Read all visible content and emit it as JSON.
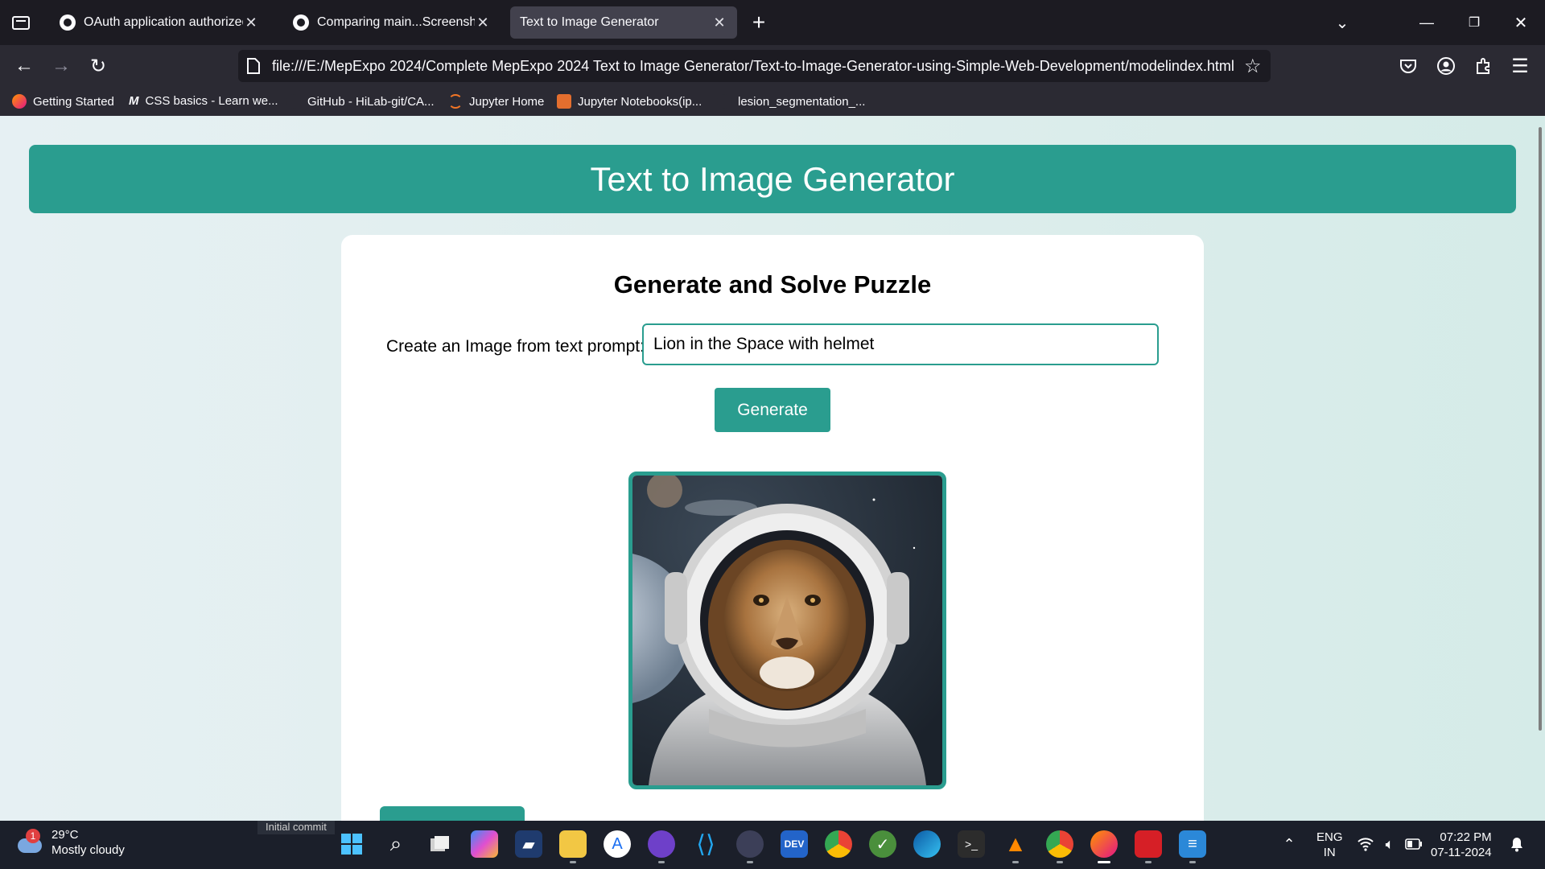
{
  "browser": {
    "tabs": [
      {
        "title": "OAuth application authorized",
        "active": false
      },
      {
        "title": "Comparing main...Screenshot-o",
        "active": false
      },
      {
        "title": "Text to Image Generator",
        "active": true
      }
    ],
    "new_tab_symbol": "+",
    "url": "file:///E:/MepExpo 2024/Complete MepExpo 2024 Text to Image Generator/Text-to-Image-Generator-using-Simple-Web-Development/modelindex.html?user",
    "bookmarks": [
      {
        "label": "Getting Started",
        "icon": "firefox-icon"
      },
      {
        "label": "CSS basics - Learn we...",
        "icon": "mdn-icon"
      },
      {
        "label": "GitHub - HiLab-git/CA...",
        "icon": "github-icon"
      },
      {
        "label": "Jupyter Home",
        "icon": "jupyter-icon"
      },
      {
        "label": "Jupyter Notebooks(ip...",
        "icon": "notebook-icon"
      },
      {
        "label": "lesion_segmentation_...",
        "icon": "page-icon"
      }
    ]
  },
  "page": {
    "header_title": "Text to Image Generator",
    "card_title": "Generate and Solve Puzzle",
    "prompt_label": "Create an Image from text prompt:",
    "prompt_value": "Lion in the Space with helmet",
    "generate_label": "Generate",
    "accent_color": "#2a9d8f"
  },
  "taskbar": {
    "weather_badge": "1",
    "temperature": "29°C",
    "condition": "Mostly cloudy",
    "commit_tooltip": "Initial commit",
    "lang_line1": "ENG",
    "lang_line2": "IN",
    "time": "07:22 PM",
    "date": "07-11-2024"
  }
}
